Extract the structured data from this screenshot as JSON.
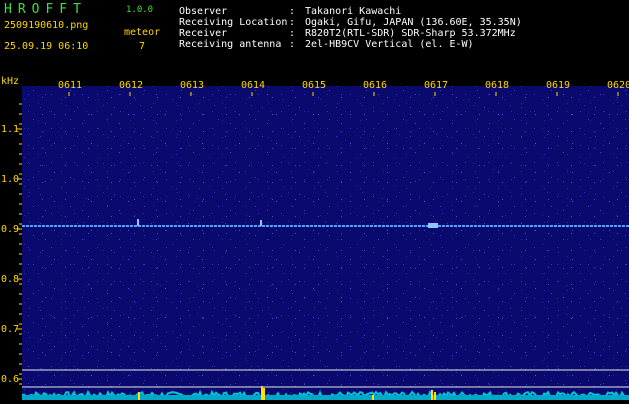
{
  "app": {
    "brand": "HROFFT",
    "version": "1.0.0",
    "filename": "2509190610.png",
    "datetime": "25.09.19 06:10",
    "meteor_label": "meteor",
    "meteor_count": "7"
  },
  "info": {
    "rows": [
      {
        "key": "Observer",
        "sep": ":",
        "value": "Takanori Kawachi"
      },
      {
        "key": "Receiving Location",
        "sep": ":",
        "value": "Ogaki, Gifu, JAPAN (136.60E, 35.35N)"
      },
      {
        "key": "Receiver",
        "sep": ":",
        "value": "R820T2(RTL-SDR) SDR-Sharp 53.372MHz"
      },
      {
        "key": "Receiving antenna",
        "sep": ":",
        "value": "2el-HB9CV Vertical (el. E-W)"
      }
    ]
  },
  "axis": {
    "unit": "kHz",
    "time_labels": [
      "0611",
      "0612",
      "0613",
      "0614",
      "0615",
      "0616",
      "0617",
      "0618",
      "0619",
      "0620"
    ],
    "freq_labels": [
      "1.1",
      "1.0",
      "0.9",
      "0.8",
      "0.7",
      "0.6"
    ]
  },
  "colors": {
    "background": "#000000",
    "spectrogram": "#0a0a6e",
    "noise_accent": "#3c5aff",
    "signal_line": "#5aa0ff",
    "header_green": "#3ce03c",
    "header_yellow": "#ffd800",
    "spectrum_baseline": "#00c8e0",
    "spectrum_peak": "#ffe000"
  }
}
